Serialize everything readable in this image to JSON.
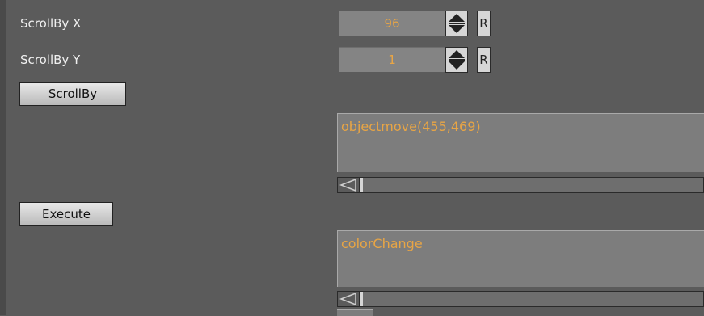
{
  "scroll_x": {
    "label": "ScrollBy X",
    "value": "96",
    "reset_label": "R",
    "spinner_icon": "updown-arrows-icon"
  },
  "scroll_y": {
    "label": "ScrollBy Y",
    "value": "1",
    "reset_label": "R",
    "spinner_icon": "updown-arrows-icon"
  },
  "scrollby_button": {
    "label": "ScrollBy"
  },
  "command_text": {
    "value": "objectmove(455,469)"
  },
  "execute_button": {
    "label": "Execute"
  },
  "event_text": {
    "value": "colorChange"
  },
  "colors": {
    "accent_text": "#e8a545",
    "panel": "#5b5b5b"
  }
}
